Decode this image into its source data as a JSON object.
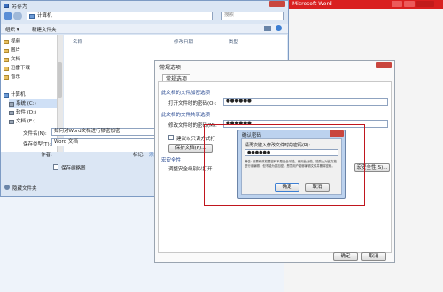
{
  "app": {
    "title": "Microsoft Word",
    "doc_title_fragment": "加密"
  },
  "save_dialog": {
    "title": "另存为",
    "address": "计算机",
    "search_placeholder": "搜索",
    "toolbar": {
      "organize": "组织 ▾",
      "new_folder": "新建文件夹"
    },
    "columns": {
      "name": "名称",
      "modified": "修改日期",
      "type": "类型"
    },
    "nav_items": [
      "视频",
      "图片",
      "文档",
      "迅雷下载",
      "音乐",
      "计算机",
      "系统 (C:)",
      "软件 (D:)",
      "文档 (E:)"
    ],
    "filename_label": "文件名(N):",
    "filename_value": "如何对Word文档进行锁密加密",
    "savetype_label": "保存类型(T):",
    "savetype_value": "Word 文档",
    "authors_label": "作者:",
    "thumbnail_label": "保存缩略图",
    "hide_folders": "隐藏文件夹",
    "tags_fragment": "标记:",
    "add_tag_fragment": "添加"
  },
  "options_dialog": {
    "title": "常规选项",
    "tab": "常规选项",
    "section_open": "此文档的文件加密选项",
    "open_password_label": "打开文件时的密码(O):",
    "open_password_value": "●●●●●●",
    "section_modify": "此文档的文件共享选项",
    "modify_password_label": "修改文件时的密码(M):",
    "modify_password_value": "●●●●●●",
    "readonly_recommend": "建议以只读方式打",
    "protect_doc": "保护文档(P)...",
    "macro_security": "宏安全性",
    "macro_desc": "调整安全级别以打开",
    "macro_button": "宏安全性(S)...",
    "ok": "确定",
    "cancel": "取消"
  },
  "confirm_dialog": {
    "title": "确认密码",
    "prompt": "请再次键入修改文件时的密码(R):",
    "value": "●●●●●●",
    "warning": "警告: 设置修改权限密码不是安全功能。使用此功能，能防止对此文档进行误编辑，但不能为其加密，恶意用户能够编辑文件并删除密码。",
    "ok": "确定",
    "cancel": "取消"
  },
  "colors": {
    "accent_red": "#d92020",
    "highlight_box": "#c0161e",
    "dialog_title": "#bcd2ee"
  }
}
